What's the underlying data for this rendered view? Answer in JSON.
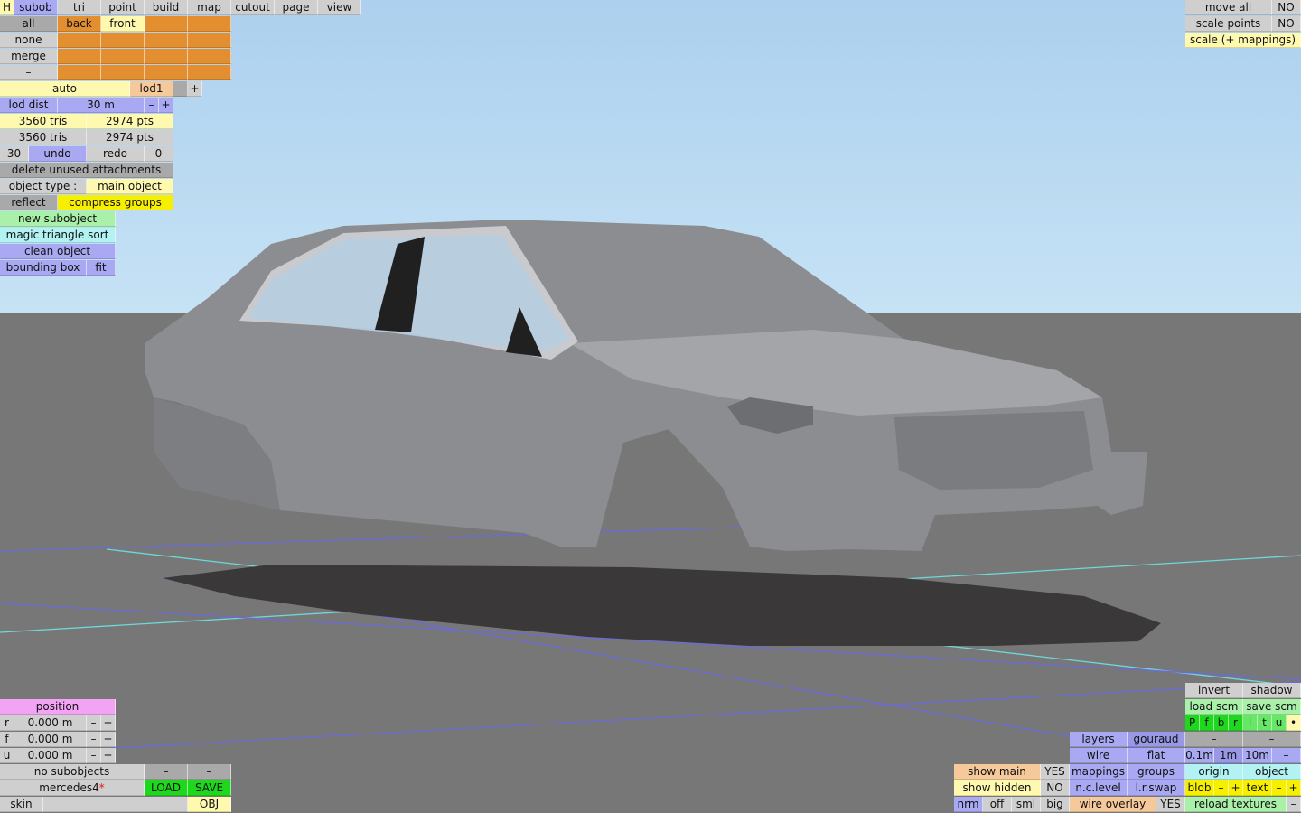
{
  "top_menu": {
    "h": "H",
    "subob": "subob",
    "tri": "tri",
    "point": "point",
    "build": "build",
    "map": "map",
    "cutout": "cutout",
    "page": "page",
    "view": "view"
  },
  "subob_grid": {
    "all": "all",
    "back": "back",
    "front": "front",
    "none": "none",
    "merge": "merge",
    "dash": "–"
  },
  "lod": {
    "auto": "auto",
    "lod1": "lod1",
    "minus": "–",
    "plus": "+",
    "lod_dist_label": "lod dist",
    "lod_dist_value": "30 m"
  },
  "stats": {
    "tris_1": "3560 tris",
    "pts_1": "2974 pts",
    "tris_2": "3560 tris",
    "pts_2": "2974 pts"
  },
  "history": {
    "undo_count": "30",
    "undo": "undo",
    "redo": "redo",
    "redo_count": "0"
  },
  "actions": {
    "delete_unused": "delete unused attachments",
    "object_type_label": "object type :",
    "object_type_value": "main object",
    "reflect": "reflect",
    "compress_groups": "compress groups",
    "new_subobject": "new subobject",
    "magic_sort": "magic triangle sort",
    "clean_object": "clean object",
    "bounding_box": "bounding box",
    "fit": "fit"
  },
  "top_right": {
    "move_all": "move all",
    "move_all_value": "NO",
    "scale_points": "scale points",
    "scale_points_value": "NO",
    "scale_mappings": "scale (+ mappings)"
  },
  "position": {
    "title": "position",
    "r_label": "r",
    "r_value": "0.000 m",
    "f_label": "f",
    "f_value": "0.000 m",
    "u_label": "u",
    "u_value": "0.000 m",
    "minus": "–",
    "plus": "+"
  },
  "file": {
    "subobjects": "no subobjects",
    "dash": "–",
    "name": "mercedes4",
    "modified_mark": "*",
    "load": "LOAD",
    "save": "SAVE",
    "skin": "skin",
    "skin_value": "",
    "obj": "OBJ"
  },
  "view_panel": {
    "invert": "invert",
    "shadow": "shadow",
    "load_scm": "load scm",
    "save_scm": "save scm",
    "views": [
      "P",
      "f",
      "b",
      "r",
      "l",
      "t",
      "u",
      "•"
    ],
    "layers": "layers",
    "gouraud": "gouraud",
    "dash": "–",
    "wire": "wire",
    "flat": "flat",
    "step_01": "0.1m",
    "step_1": "1m",
    "step_10": "10m",
    "show_main": "show main",
    "show_main_value": "YES",
    "mappings": "mappings",
    "groups": "groups",
    "origin": "origin",
    "object": "object",
    "show_hidden": "show hidden",
    "show_hidden_value": "NO",
    "nc_level": "n.c.level",
    "lr_swap": "l.r.swap",
    "blob": "blob",
    "text": "text",
    "minus": "–",
    "plus": "+",
    "nrm": "nrm",
    "off": "off",
    "sml": "sml",
    "big": "big",
    "wire_overlay": "wire overlay",
    "wire_overlay_value": "YES",
    "reload_textures": "reload textures"
  },
  "colors": {
    "sky": "#acd0ee",
    "ground": "#777777",
    "car_body": "#8e9094",
    "shadow": "#3a3838",
    "grid_blue": "#6b6bd8",
    "grid_cyan": "#6fd8d8",
    "orange": "#e38f30",
    "blue": "#a9a9f3",
    "green": "#1ed81e"
  }
}
